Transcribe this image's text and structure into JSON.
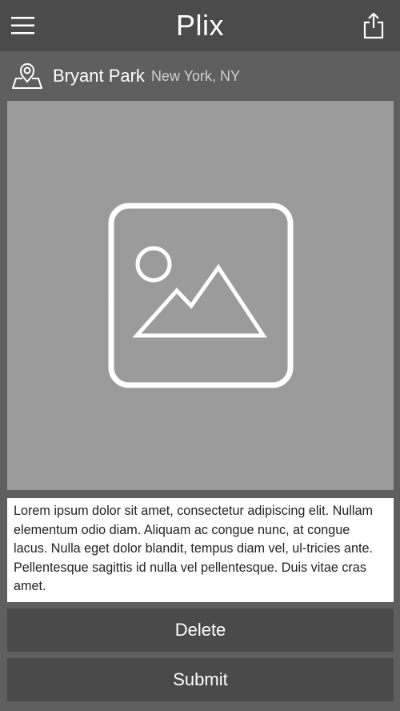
{
  "header": {
    "title": "Plix",
    "menu_icon": "hamburger-menu-icon",
    "share_icon": "share-icon"
  },
  "location": {
    "icon": "location-pin-icon",
    "name": "Bryant Park",
    "city": "New York, NY"
  },
  "photo": {
    "icon": "image-placeholder-icon"
  },
  "description": {
    "text": "Lorem ipsum dolor sit amet, consectetur adipiscing elit. Nullam elementum odio diam. Aliquam ac congue nunc, at congue lacus. Nulla eget dolor blandit, tempus diam vel, ul-tricies ante. Pellentesque sagittis id nulla vel pellentesque. Duis vitae cras amet."
  },
  "actions": {
    "delete_label": "Delete",
    "submit_label": "Submit"
  },
  "colors": {
    "header_bg": "#4b4b4b",
    "page_bg": "#5f5f5f",
    "photo_bg": "#9b9b9b",
    "button_bg": "#4a4a4a",
    "text_on_dark": "#ffffff"
  }
}
